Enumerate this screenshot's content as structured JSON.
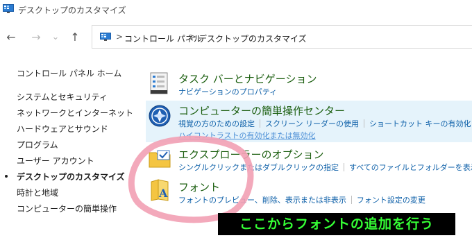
{
  "window": {
    "title": "デスクトップのカスタマイズ"
  },
  "nav": {
    "back": "←",
    "forward": "→",
    "recent": "⌄",
    "up": "↑"
  },
  "address": {
    "crumbs": [
      "コントロール パネル",
      "デスクトップのカスタマイズ"
    ],
    "separator": ">"
  },
  "sidebar": {
    "home": "コントロール パネル ホーム",
    "items": [
      {
        "label": "システムとセキュリティ"
      },
      {
        "label": "ネットワークとインターネット"
      },
      {
        "label": "ハードウェアとサウンド"
      },
      {
        "label": "プログラム"
      },
      {
        "label": "ユーザー アカウント"
      },
      {
        "label": "デスクトップのカスタマイズ",
        "current": true
      },
      {
        "label": "時計と地域"
      },
      {
        "label": "コンピューターの簡単操作"
      }
    ]
  },
  "categories": [
    {
      "title": "タスク バーとナビゲーション",
      "links": [
        "ナビゲーションのプロパティ"
      ],
      "icon": "taskbar-icon"
    },
    {
      "title": "コンピューターの簡単操作センター",
      "links": [
        "視覚の方のための設定",
        "スクリーン リーダーの使用",
        "ショートカット キーの有効化"
      ],
      "links2": [
        "ハイコントラストの有効化または無効化"
      ],
      "icon": "ease-of-access-icon"
    },
    {
      "title": "エクスプローラーのオプション",
      "links": [
        "シングルクリックまたはダブルクリックの指定",
        "すべてのファイルとフォルダーを表示"
      ],
      "icon": "folder-options-icon"
    },
    {
      "title": "フォント",
      "links": [
        "フォントのプレビュー、削除、表示または非表示",
        "フォント設定の変更"
      ],
      "icon": "fonts-icon"
    }
  ],
  "annotation": {
    "text": "ここからフォントの追加を行う"
  },
  "colors": {
    "title_green": "#1c5f10",
    "link_blue": "#0c5fa8",
    "highlight": "#e5f3fb",
    "annotation_text": "#35ff35",
    "ring": "#f2a0b4"
  }
}
